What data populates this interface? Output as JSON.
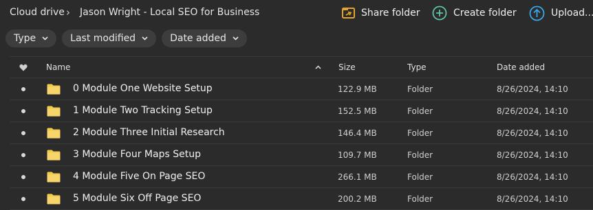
{
  "breadcrumb": {
    "root": "Cloud drive",
    "current": "Jason Wright - Local SEO for Business"
  },
  "actions": {
    "share_folder": "Share folder",
    "create_folder": "Create folder",
    "upload": "Upload..."
  },
  "filters": [
    "Type",
    "Last modified",
    "Date added"
  ],
  "columns": {
    "name": "Name",
    "size": "Size",
    "type": "Type",
    "date_added": "Date added"
  },
  "rows": [
    {
      "name": "0 Module One Website Setup",
      "size": "122.9 MB",
      "type": "Folder",
      "date_added": "8/26/2024, 14:10"
    },
    {
      "name": "1 Module Two Tracking Setup",
      "size": "152.5 MB",
      "type": "Folder",
      "date_added": "8/26/2024, 14:10"
    },
    {
      "name": "2 Module Three Initial Research",
      "size": "146.4 MB",
      "type": "Folder",
      "date_added": "8/26/2024, 14:10"
    },
    {
      "name": "3 Module Four Maps Setup",
      "size": "109.7 MB",
      "type": "Folder",
      "date_added": "8/26/2024, 14:10"
    },
    {
      "name": "4 Module Five On Page SEO",
      "size": "266.1 MB",
      "type": "Folder",
      "date_added": "8/26/2024, 14:10"
    },
    {
      "name": "5 Module Six Off Page SEO",
      "size": "200.2 MB",
      "type": "Folder",
      "date_added": "8/26/2024, 14:10"
    }
  ],
  "colors": {
    "background": "#2b2b2b",
    "share_icon": "#e5a42b",
    "create_icon": "#5fc4a8",
    "upload_icon": "#3aa5e8",
    "folder_icon": "#f2c94c"
  },
  "icons": {
    "share": "share-folder-icon",
    "create": "plus-circle-icon",
    "upload": "upload-arrow-icon",
    "folder": "folder-icon",
    "favourite": "heart-icon",
    "sort": "sort-ascending-icon",
    "chevron": "chevron-down-icon"
  }
}
